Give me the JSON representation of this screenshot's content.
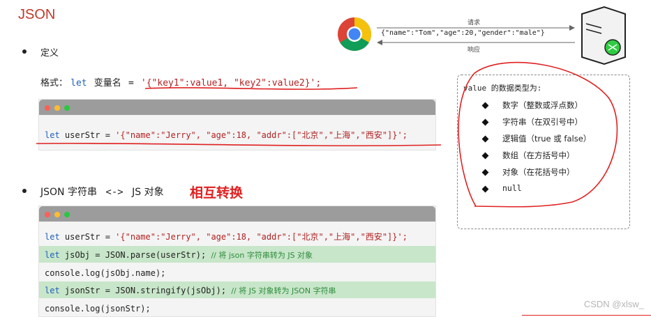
{
  "title": "JSON",
  "section1": {
    "label": "定义"
  },
  "format_line": {
    "prefix": "格式：",
    "kw": "let",
    "varname": "变量名",
    "eq": "=",
    "value": "'{\"key1\":value1, \"key2\":value2}';"
  },
  "code1": {
    "kw": "let",
    "rest": " userStr = ",
    "str": "'{\"name\":\"Jerry\", \"age\":18, \"addr\":[\"北京\",\"上海\",\"西安\"]}';"
  },
  "diagram": {
    "request_label": "请求",
    "response_label": "响应",
    "payload": "{\"name\":\"Tom\",\"age\":20,\"gender\":\"male\"}"
  },
  "panel": {
    "header": "value  的数据类型为:",
    "items": [
      "数字（整数或浮点数）",
      "字符串（在双引号中）",
      "逻辑值（true 或 false）",
      "数组（在方括号中）",
      "对象（在花括号中）",
      "null"
    ]
  },
  "section2": {
    "label_a": "JSON 字符串",
    "arrow": "<->",
    "label_b": "JS 对象",
    "emphasis": "相互转换"
  },
  "code2": {
    "line1_kw": "let",
    "line1_rest": " userStr = ",
    "line1_str": "'{\"name\":\"Jerry\", \"age\":18, \"addr\":[\"北京\",\"上海\",\"西安\"]}';",
    "line2_kw": "let",
    "line2_rest": " jsObj = JSON.parse(userStr); ",
    "line2_cmt": "// 将 json 字符串转为 JS 对象",
    "line3": "console.log(jsObj.name);",
    "line4_kw": "let",
    "line4_rest": " jsonStr = JSON.stringify(jsObj); ",
    "line4_cmt": "// 将 JS 对象转为 JSON 字符串",
    "line5": "console.log(jsonStr);"
  },
  "watermark": "CSDN @xlsw_",
  "colors": {
    "title": "#c0392b",
    "annotation": "#e02020",
    "keyword": "#1f5fbf",
    "comment": "#2e8b3d"
  }
}
